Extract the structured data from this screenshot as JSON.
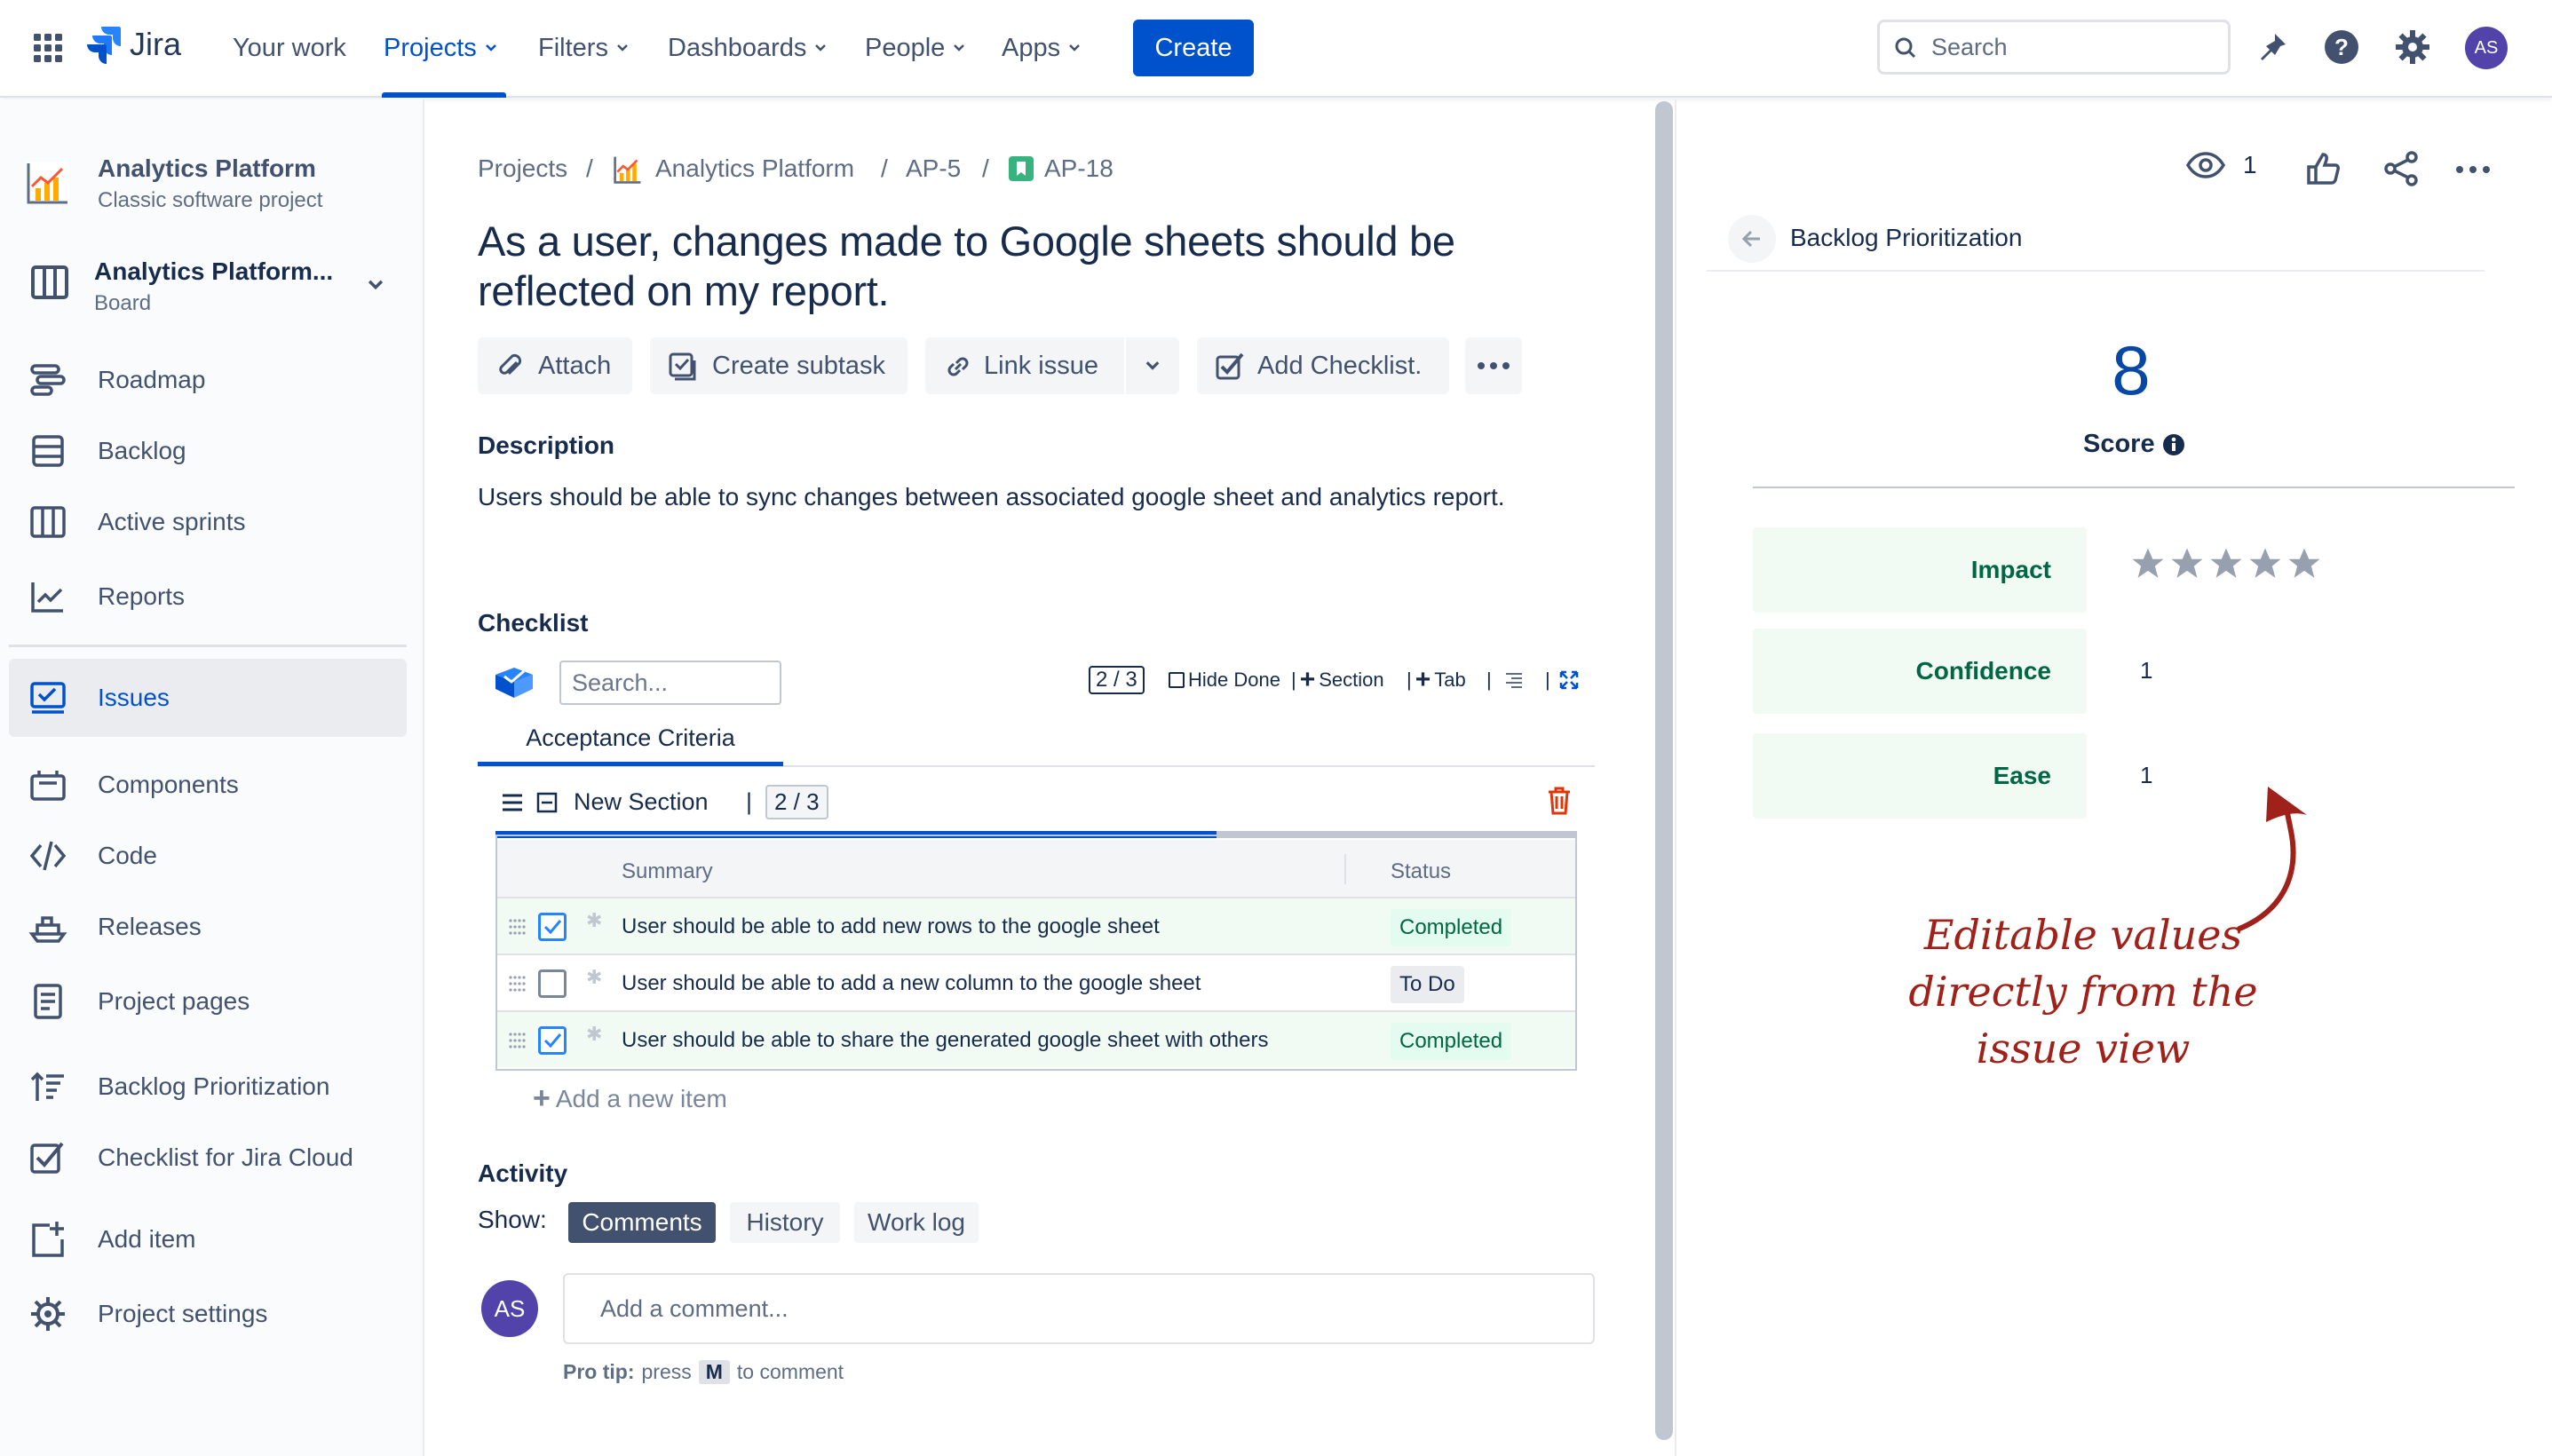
{
  "topnav": {
    "app_name": "Jira",
    "items": [
      {
        "label": "Your work",
        "dropdown": false
      },
      {
        "label": "Projects",
        "dropdown": true,
        "active": true
      },
      {
        "label": "Filters",
        "dropdown": true
      },
      {
        "label": "Dashboards",
        "dropdown": true
      },
      {
        "label": "People",
        "dropdown": true
      },
      {
        "label": "Apps",
        "dropdown": true
      }
    ],
    "create_label": "Create",
    "search_placeholder": "Search",
    "avatar_initials": "AS"
  },
  "sidebar": {
    "project_name": "Analytics Platform",
    "project_type": "Classic software project",
    "board_name": "Analytics Platform...",
    "board_sub": "Board",
    "items": [
      {
        "label": "Roadmap",
        "icon": "roadmap-icon"
      },
      {
        "label": "Backlog",
        "icon": "backlog-icon"
      },
      {
        "label": "Active sprints",
        "icon": "columns-icon"
      },
      {
        "label": "Reports",
        "icon": "chart-line-icon"
      },
      {
        "label": "Issues",
        "icon": "issues-icon",
        "active": true
      },
      {
        "label": "Components",
        "icon": "component-icon"
      },
      {
        "label": "Code",
        "icon": "code-icon"
      },
      {
        "label": "Releases",
        "icon": "ship-icon"
      },
      {
        "label": "Project pages",
        "icon": "page-icon"
      },
      {
        "label": "Backlog Prioritization",
        "icon": "sort-icon"
      },
      {
        "label": "Checklist for Jira Cloud",
        "icon": "checkbox-icon"
      },
      {
        "label": "Add item",
        "icon": "add-item-icon"
      },
      {
        "label": "Project settings",
        "icon": "gear-icon"
      }
    ]
  },
  "breadcrumb": {
    "projects": "Projects",
    "project": "Analytics Platform",
    "parent": "AP-5",
    "issue": "AP-18",
    "separator": "/"
  },
  "issue": {
    "title": "As a user, changes made to Google sheets should be reflected on my report.",
    "toolbar": {
      "attach": "Attach",
      "create_subtask": "Create subtask",
      "link_issue": "Link issue",
      "add_checklist": "Add Checklist."
    },
    "description_heading": "Description",
    "description": "Users should be able to sync changes between associated google sheet and analytics report."
  },
  "checklist": {
    "heading": "Checklist",
    "search_placeholder": "Search...",
    "progress": "2 / 3",
    "hide_done": "Hide Done",
    "section_btn": "Section",
    "tab_btn": "Tab",
    "tab_name": "Acceptance Criteria",
    "section_name": "New Section",
    "section_progress": "2 / 3",
    "progress_fraction": 0.667,
    "columns": {
      "summary": "Summary",
      "status": "Status"
    },
    "items": [
      {
        "text": "User should be able to add new rows to the google sheet",
        "status": "Completed",
        "checked": true
      },
      {
        "text": "User should be able to add a new column to the google sheet",
        "status": "To Do",
        "checked": false
      },
      {
        "text": "User should be able to share the generated google sheet with others",
        "status": "Completed",
        "checked": true
      }
    ],
    "add_item": "Add a new item"
  },
  "activity": {
    "heading": "Activity",
    "show_label": "Show:",
    "filters": [
      "Comments",
      "History",
      "Work log"
    ],
    "comment_placeholder": "Add a comment...",
    "avatar_initials": "AS",
    "tip_bold": "Pro tip:",
    "tip_press": "press",
    "tip_key": "M",
    "tip_rest": "to comment"
  },
  "panel": {
    "watch_count": "1",
    "title": "Backlog Prioritization",
    "score_value": "8",
    "score_label": "Score",
    "fields": [
      {
        "label": "Impact",
        "value": "",
        "stars": 0,
        "max_stars": 5
      },
      {
        "label": "Confidence",
        "value": "1"
      },
      {
        "label": "Ease",
        "value": "1"
      }
    ],
    "annotation": [
      "Editable values",
      "directly from the",
      "issue view"
    ]
  },
  "colors": {
    "brand": "#0052CC",
    "completed": "#006644",
    "annotation": "#A0201A"
  }
}
